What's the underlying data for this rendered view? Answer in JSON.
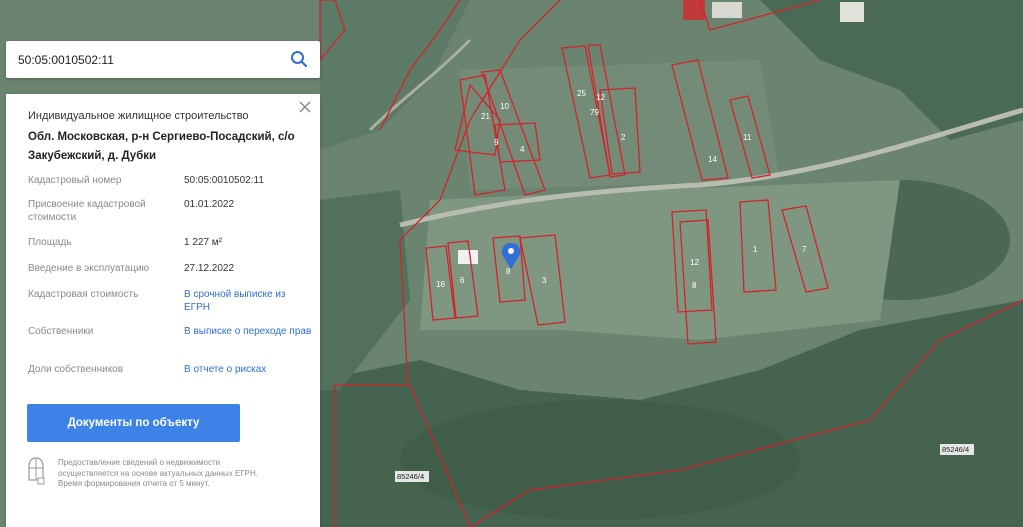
{
  "search": {
    "value": "50:05:0010502:11"
  },
  "panel": {
    "type": "Индивидуальное жилищное строительство",
    "address": "Обл. Московская, р-н Сергиево-Посадский, с/о Закубежский, д. Дубки",
    "rows": [
      {
        "label": "Кадастровый номер",
        "value": "50:05:0010502:11"
      },
      {
        "label": "Присвоение кадастровой стоимости",
        "value": "01.01.2022"
      },
      {
        "label": "Площадь",
        "value": "1 227 м²"
      },
      {
        "label": "Введение в эксплуатацию",
        "value": "27.12.2022"
      },
      {
        "label": "Кадастровая стоимость",
        "value": "В срочной выписке из ЕГРН"
      },
      {
        "label": "Собственники",
        "value": "В выписке о переходе прав"
      },
      {
        "label": "Доли собственников",
        "value": "В отчете о рисках"
      }
    ],
    "docs_button": "Документы по объекту",
    "footer": "Предоставление сведений о недвижимости осуществляется на основе актуальных данных ЕГРН. Время формирования отчета от 5 минут."
  },
  "map": {
    "plot_labels": [
      "21",
      "10",
      "9",
      "4",
      "25",
      "12",
      "79",
      "2",
      "14",
      "11",
      "12",
      "8",
      "1",
      "7",
      "16",
      "6",
      "8",
      "3"
    ],
    "road_labels": [
      "85246/4",
      "85246/4"
    ]
  },
  "colors": {
    "accent": "#3d82e6",
    "link": "#2f6fd6",
    "boundary": "#d2232a"
  }
}
